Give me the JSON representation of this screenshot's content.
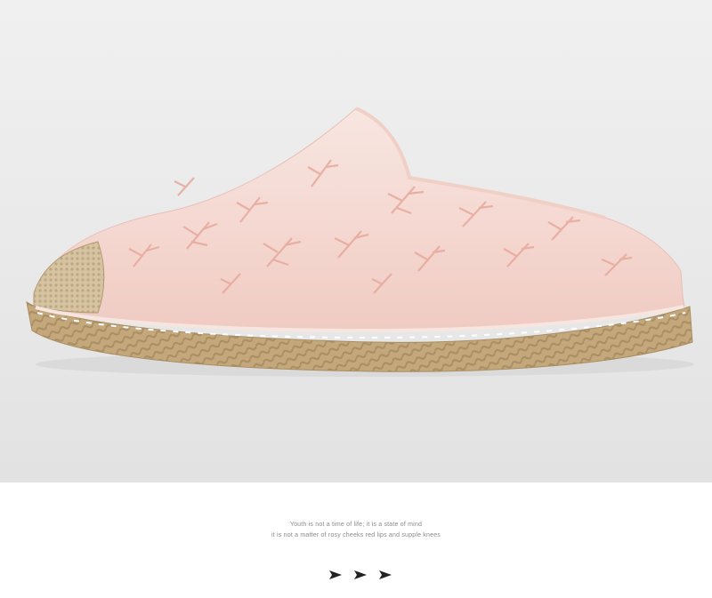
{
  "caption": {
    "line1": "Youth is not a time of life; it is a state of mind",
    "line2": "it is not a matter of rosy cheeks red lips and supple knees"
  },
  "arrow_icon": "triangle-right-icon",
  "colors": {
    "background": "#ffffff",
    "photo_backdrop": "#ececec",
    "shoe_upper": "#f6dcd6",
    "embroidery": "#eab1a6",
    "jute_sole": "#c7ab80",
    "caption_text": "#8a8a8a",
    "arrow": "#222222"
  }
}
